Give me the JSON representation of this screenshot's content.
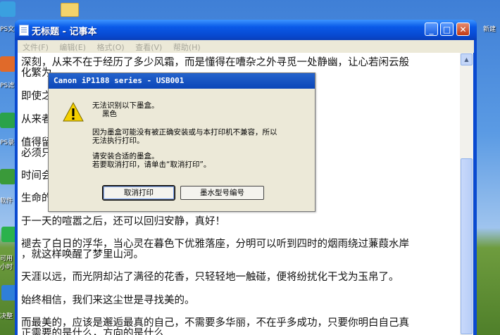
{
  "desktop": {
    "icon_labels": [
      "PS文",
      "PS滤",
      "PS录",
      "软件",
      "可用",
      "小时",
      "决整"
    ],
    "right_icon_label": "新建"
  },
  "notepad": {
    "title": "无标题 - 记事本",
    "menu": [
      "文件(F)",
      "编辑(E)",
      "格式(O)",
      "查看(V)",
      "帮助(H)"
    ],
    "lines": [
      "深刻，从来不在于经历了多少风霜，而是懂得在嘈杂之外寻觅一处静幽，让心若闲云般",
      "化繁为",
      "即使之",
      "从来者",
      "值得留                                                                                     就学会放手，没有什么东西",
      "必须只",
      "时间会                                                                                     你的珍贵。",
      "生命的                                                                                     一生珍藏。",
      "于一天的喧嚣之后，还可以回归安静，真好！",
      "褪去了白日的浮华，当心灵在暮色下优雅落座，分明可以听到四时的烟雨绕过蒹葭水岸",
      "，就这样唤醒了梦里山河。",
      "天涯以远，而光阴却沾了满径的花香，只轻轻地一触碰，便将纷扰化干戈为玉帛了。",
      "始终相信，我们来这尘世是寻找美的。",
      "而最美的，应该是邂逅最真的自己，不需要多华丽，不在乎多成功，只要你明白自己真",
      "正需要的是什么，方向的是什么"
    ]
  },
  "dialog": {
    "title": "Canon iP1188 series - USB001",
    "line1": "无法识别以下墨盒。",
    "line2": "黑色",
    "line3": "因为墨盒可能没有被正确安装或与本打印机不兼容，所以",
    "line4": "无法执行打印。",
    "line5": "请安装合适的墨盒。",
    "line6": "若要取消打印，请单击“取消打印”。",
    "cancel_label": "取消打印",
    "model_label": "墨水型号编号"
  },
  "colors": {
    "titlebar": "#0a4ad0",
    "dialog_bg": "#ece9d8",
    "warning": "#f5d000"
  }
}
